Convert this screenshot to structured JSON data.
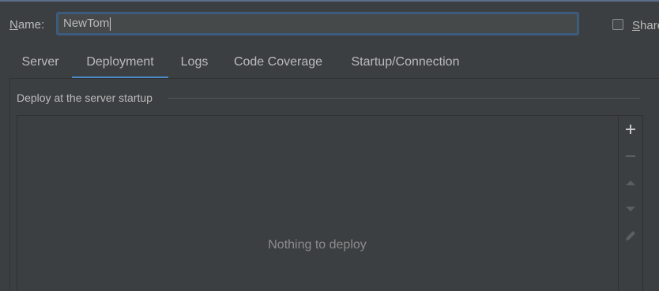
{
  "name_field": {
    "label": "Name:",
    "mnemonic": "N",
    "label_rest": "ame:",
    "value": "NewTom"
  },
  "share": {
    "mnemonic": "S",
    "label_rest": "hare",
    "checked": false
  },
  "tabs": [
    {
      "label": "Server",
      "active": false
    },
    {
      "label": "Deployment",
      "active": true
    },
    {
      "label": "Logs",
      "active": false
    },
    {
      "label": "Code Coverage",
      "active": false
    },
    {
      "label": "Startup/Connection",
      "active": false
    }
  ],
  "deployment": {
    "group_title": "Deploy at the server startup",
    "empty_text": "Nothing to deploy",
    "toolbar": [
      {
        "icon": "plus-icon",
        "enabled": true
      },
      {
        "icon": "minus-icon",
        "enabled": false
      },
      {
        "icon": "arrow-up-icon",
        "enabled": false
      },
      {
        "icon": "arrow-down-icon",
        "enabled": false
      },
      {
        "icon": "edit-pencil-icon",
        "enabled": false
      }
    ]
  },
  "colors": {
    "accent": "#4a88c7",
    "background": "#3c3f41",
    "text": "#bbbbbb",
    "input_focus_border": "#3d5b7d"
  }
}
